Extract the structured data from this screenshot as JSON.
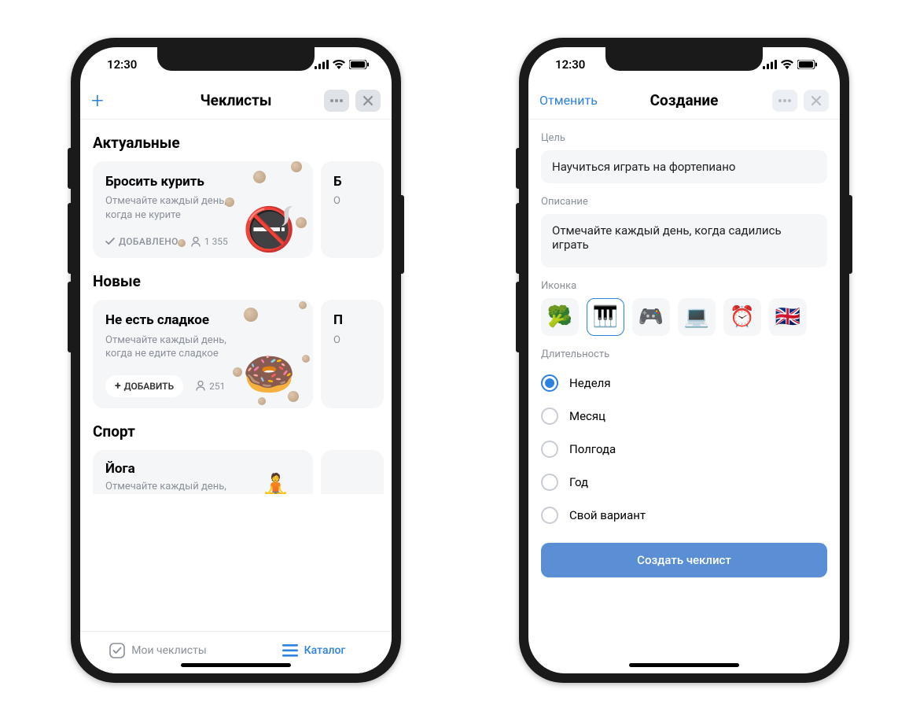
{
  "status": {
    "time": "12:30"
  },
  "left": {
    "title": "Чеклисты",
    "sections": {
      "current": {
        "title": "Актуальные",
        "card": {
          "title": "Бросить курить",
          "desc": "Отмечайте каждый день, когда не курите",
          "added_label": "ДОБАВЛЕНО",
          "count": "1 355",
          "emoji": "🚭"
        },
        "peek": {
          "title_frag": "Б",
          "desc_frag": "О"
        }
      },
      "new": {
        "title": "Новые",
        "card": {
          "title": "Не есть сладкое",
          "desc": "Отмечайте каждый день, когда не едите сладкое",
          "add_label": "ДОБАВИТЬ",
          "count": "251",
          "emoji": "🍩"
        },
        "peek": {
          "title_frag": "П",
          "desc_frag": "О"
        }
      },
      "sport": {
        "title": "Спорт",
        "card": {
          "title": "Йога",
          "desc": "Отмечайте каждый день,",
          "emoji": "🧘"
        }
      }
    },
    "tabs": {
      "my": "Мои чеклисты",
      "catalog": "Каталог"
    }
  },
  "right": {
    "cancel": "Отменить",
    "title": "Создание",
    "goal": {
      "label": "Цель",
      "value": "Научиться играть на фортепиано"
    },
    "description": {
      "label": "Описание",
      "value": "Отмечайте каждый день, когда садились играть"
    },
    "icon_label": "Иконка",
    "icons": [
      "🥦",
      "🎹",
      "🎮",
      "💻",
      "⏰",
      "🇬🇧"
    ],
    "selected_icon_index": 1,
    "duration": {
      "label": "Длительность",
      "options": [
        "Неделя",
        "Месяц",
        "Полгода",
        "Год",
        "Свой вариант"
      ],
      "selected_index": 0
    },
    "submit": "Создать чеклист"
  }
}
